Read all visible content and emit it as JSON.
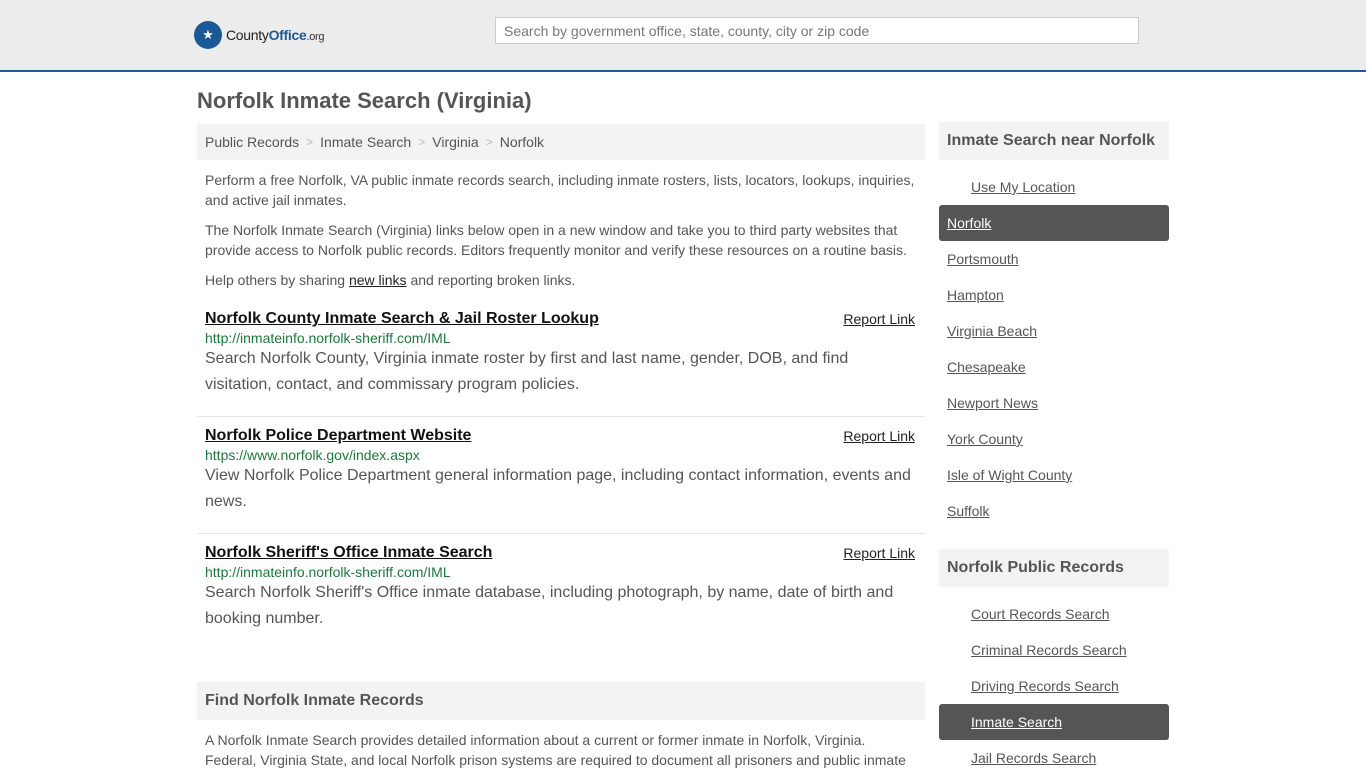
{
  "header": {
    "logo_icon": "★",
    "logo_brand_a": "County",
    "logo_brand_b": "Office",
    "logo_tld": ".org",
    "search_placeholder": "Search by government office, state, county, city or zip code"
  },
  "page_title": "Norfolk Inmate Search (Virginia)",
  "breadcrumb": [
    "Public Records",
    "Inmate Search",
    "Virginia",
    "Norfolk"
  ],
  "breadcrumb_sep": ">",
  "intro": {
    "p1": "Perform a free Norfolk, VA public inmate records search, including inmate rosters, lists, locators, lookups, inquiries, and active jail inmates.",
    "p2": "The Norfolk Inmate Search (Virginia) links below open in a new window and take you to third party websites that provide access to Norfolk public records. Editors frequently monitor and verify these resources on a routine basis.",
    "p3_before": "Help others by sharing ",
    "p3_link": "new links",
    "p3_after": " and reporting broken links."
  },
  "results": [
    {
      "title": "Norfolk County Inmate Search & Jail Roster Lookup",
      "report": "Report Link",
      "url": "http://inmateinfo.norfolk-sheriff.com/IML",
      "desc": "Search Norfolk County, Virginia inmate roster by first and last name, gender, DOB, and find visitation, contact, and commissary program policies."
    },
    {
      "title": "Norfolk Police Department Website",
      "report": "Report Link",
      "url": "https://www.norfolk.gov/index.aspx",
      "desc": "View Norfolk Police Department general information page, including contact information, events and news."
    },
    {
      "title": "Norfolk Sheriff's Office Inmate Search",
      "report": "Report Link",
      "url": "http://inmateinfo.norfolk-sheriff.com/IML",
      "desc": "Search Norfolk Sheriff's Office inmate database, including photograph, by name, date of birth and booking number."
    }
  ],
  "find_section": {
    "title": "Find Norfolk Inmate Records",
    "text": "A Norfolk Inmate Search provides detailed information about a current or former inmate in Norfolk, Virginia. Federal, Virginia State, and local Norfolk prison systems are required to document all prisoners and public inmate"
  },
  "sidebar": {
    "near_title": "Inmate Search near Norfolk",
    "use_location": "Use My Location",
    "near_items": [
      "Norfolk",
      "Portsmouth",
      "Hampton",
      "Virginia Beach",
      "Chesapeake",
      "Newport News",
      "York County",
      "Isle of Wight County",
      "Suffolk"
    ],
    "records_title": "Norfolk Public Records",
    "records_items": [
      "Court Records Search",
      "Criminal Records Search",
      "Driving Records Search",
      "Inmate Search",
      "Jail Records Search"
    ]
  }
}
